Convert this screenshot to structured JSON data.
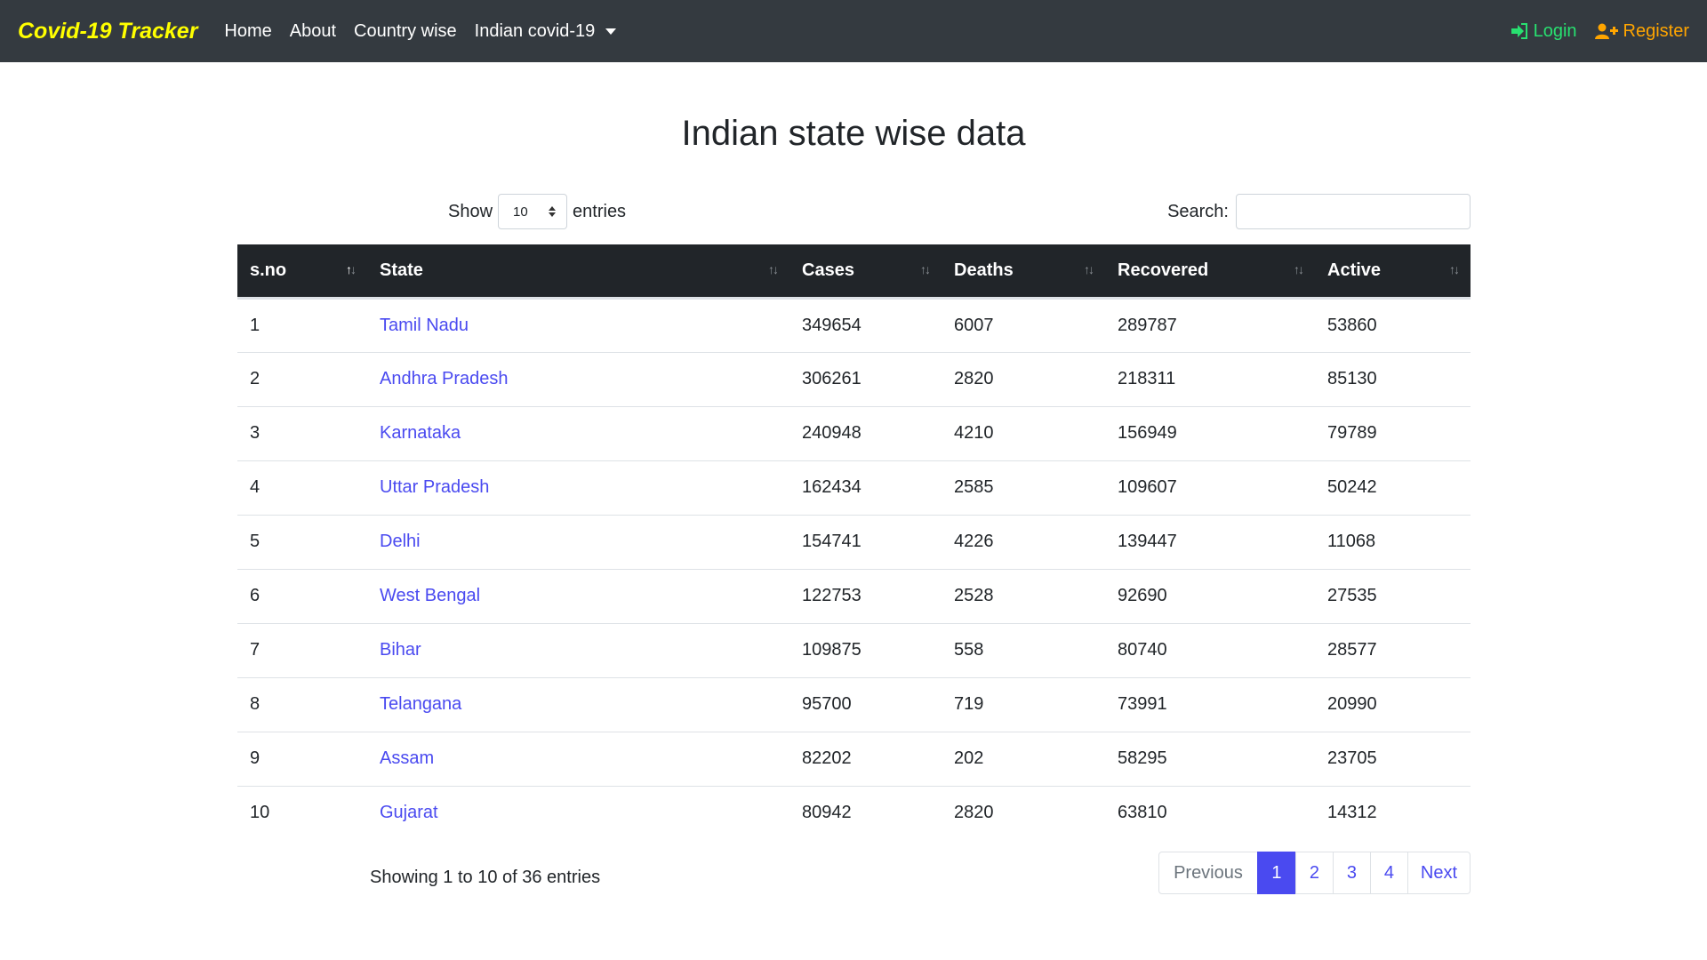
{
  "navbar": {
    "brand": "Covid-19 Tracker",
    "links": [
      "Home",
      "About",
      "Country wise"
    ],
    "dropdown_label": "Indian covid-19",
    "login_label": "Login",
    "register_label": "Register",
    "colors": {
      "brand": "#ffff00",
      "login": "#28e070",
      "register": "#ffa500",
      "background": "#343a40"
    }
  },
  "page": {
    "title": "Indian state wise data"
  },
  "controls": {
    "show_label": "Show",
    "entries_label": "entries",
    "page_length": "10",
    "search_label": "Search:",
    "search_value": ""
  },
  "table": {
    "headers": [
      "s.no",
      "State",
      "Cases",
      "Deaths",
      "Recovered",
      "Active"
    ],
    "rows": [
      [
        "1",
        "Tamil Nadu",
        "349654",
        "6007",
        "289787",
        "53860"
      ],
      [
        "2",
        "Andhra Pradesh",
        "306261",
        "2820",
        "218311",
        "85130"
      ],
      [
        "3",
        "Karnataka",
        "240948",
        "4210",
        "156949",
        "79789"
      ],
      [
        "4",
        "Uttar Pradesh",
        "162434",
        "2585",
        "109607",
        "50242"
      ],
      [
        "5",
        "Delhi",
        "154741",
        "4226",
        "139447",
        "11068"
      ],
      [
        "6",
        "West Bengal",
        "122753",
        "2528",
        "92690",
        "27535"
      ],
      [
        "7",
        "Bihar",
        "109875",
        "558",
        "80740",
        "28577"
      ],
      [
        "8",
        "Telangana",
        "95700",
        "719",
        "73991",
        "20990"
      ],
      [
        "9",
        "Assam",
        "82202",
        "202",
        "58295",
        "23705"
      ],
      [
        "10",
        "Gujarat",
        "80942",
        "2820",
        "63810",
        "14312"
      ]
    ]
  },
  "footer": {
    "info": "Showing 1 to 10 of 36 entries",
    "previous_label": "Previous",
    "pages": [
      "1",
      "2",
      "3",
      "4"
    ],
    "current_page": "1",
    "next_label": "Next"
  }
}
